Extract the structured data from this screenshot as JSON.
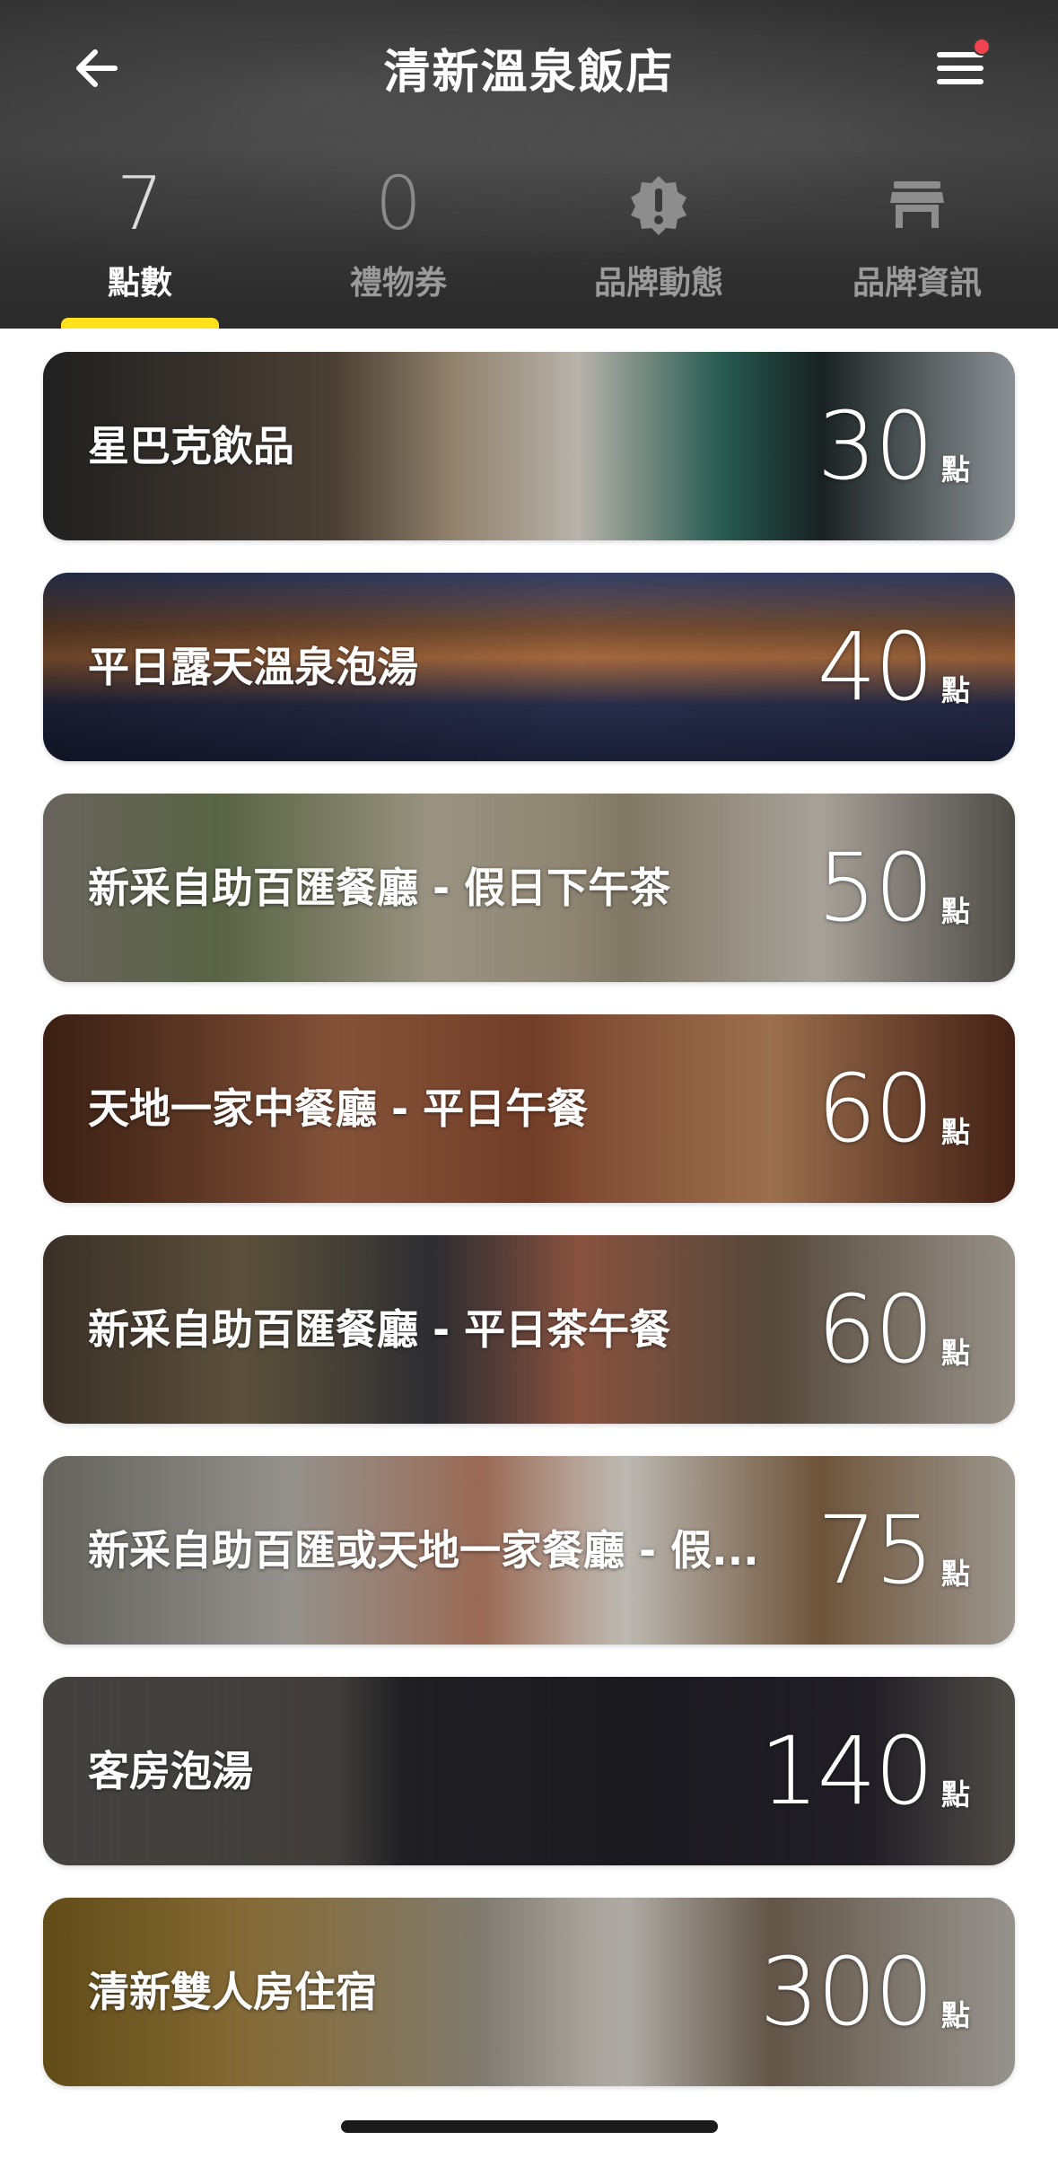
{
  "header": {
    "title": "清新溫泉飯店",
    "back_icon": "arrow-left-icon",
    "menu_icon": "hamburger-menu-icon",
    "menu_badge_color": "#f0424f"
  },
  "tabs": [
    {
      "value": "7",
      "label": "點數",
      "active": true
    },
    {
      "value": "0",
      "label": "禮物券",
      "active": false
    },
    {
      "icon": "alert-badge-icon",
      "label": "品牌動態",
      "active": false
    },
    {
      "icon": "store-icon",
      "label": "品牌資訊",
      "active": false
    }
  ],
  "accent_color": "#ffe01b",
  "rewards": [
    {
      "name": "星巴克飲品",
      "points": "30",
      "unit": "點"
    },
    {
      "name": "平日露天溫泉泡湯",
      "points": "40",
      "unit": "點"
    },
    {
      "name": "新采自助百匯餐廳 - 假日下午茶",
      "points": "50",
      "unit": "點"
    },
    {
      "name": "天地一家中餐廳 - 平日午餐",
      "points": "60",
      "unit": "點"
    },
    {
      "name": "新采自助百匯餐廳 - 平日茶午餐",
      "points": "60",
      "unit": "點"
    },
    {
      "name": "新采自助百匯或天地一家餐廳 - 假...",
      "points": "75",
      "unit": "點"
    },
    {
      "name": "客房泡湯",
      "points": "140",
      "unit": "點"
    },
    {
      "name": "清新雙人房住宿",
      "points": "300",
      "unit": "點"
    }
  ]
}
